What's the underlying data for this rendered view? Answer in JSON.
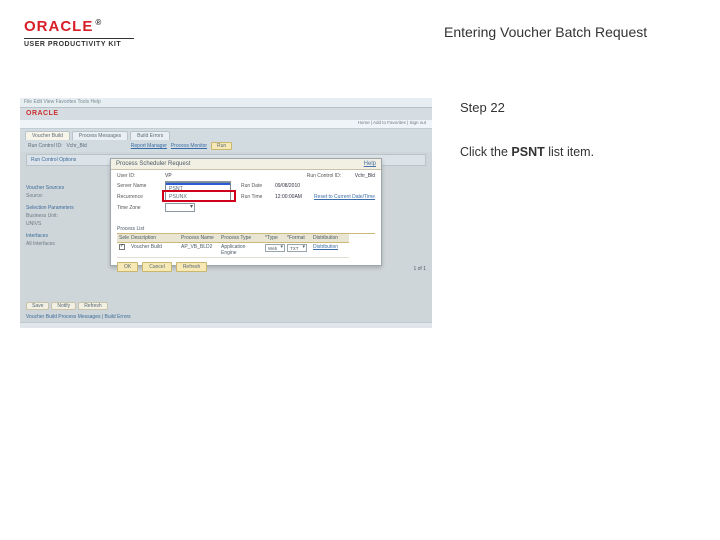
{
  "header": {
    "logo_main": "ORACLE",
    "logo_reg": "®",
    "logo_sub": "USER PRODUCTIVITY KIT",
    "doc_title": "Entering Voucher Batch Request"
  },
  "instruction": {
    "step_label": "Step 22",
    "action_pre": "Click the ",
    "action_bold": "PSNT",
    "action_post": " list item."
  },
  "shot": {
    "chrome_text": "File  Edit  View  Favorites  Tools  Help",
    "brand": "ORACLE",
    "subnav": "Home  |  Add to Favorites  |  Sign out",
    "tabs": [
      "Voucher Build",
      "Process Messages",
      "Build Errors"
    ],
    "row_labels": {
      "runcntl": "Run Control ID:",
      "runcntl_val": "Vchr_Bld",
      "report_mgr": "Report Manager",
      "proc_monitor": "Process Monitor",
      "run": "Run"
    },
    "group_header": "Run Control Options",
    "side": {
      "hdr1": "Voucher Sources",
      "v1": "Source:",
      "hdr2": "Selection Parameters",
      "v2": "Business Unit:",
      "v3": "UNIVS",
      "hdr3": "Interfaces",
      "v4": "All Interfaces"
    },
    "foot_tabs": [
      "Save",
      "Notify",
      "Refresh"
    ],
    "footline": "Voucher Build Process Messages | Build Errors",
    "nav_right": "1 of 1"
  },
  "modal": {
    "title": "Process Scheduler Request",
    "help": "Help",
    "user_lbl": "User ID:",
    "user_val": "VP",
    "runctl_lbl": "Run Control ID:",
    "runctl_val": "Vchr_Bld",
    "server_lbl": "Server Name",
    "server_sel": "",
    "rundate_lbl": "Run Date",
    "rundate_val": "09/08/2010",
    "recur_lbl": "Recurrence",
    "recur_sel": "",
    "runtime_lbl": "Run Time",
    "runtime_val": "12:00:00AM",
    "reset_link": "Reset to Current Date/Time",
    "tz_lbl": "Time Zone",
    "tz_sel": "",
    "list_header": "Process List",
    "th": [
      "Select",
      "Description",
      "Process Name",
      "Process Type",
      "*Type",
      "*Format",
      "Distribution"
    ],
    "row": {
      "desc": "Voucher Build",
      "pname": "AP_VB_BLD2",
      "ptype": "Application Engine",
      "type": "Web",
      "format": "TXT",
      "dist": "Distribution"
    },
    "btns": [
      "OK",
      "Cancel",
      "Refresh"
    ],
    "dropdown": {
      "opt_blank": " ",
      "opt_psnt": "PSNT",
      "opt_psunx": "PSUNX"
    }
  }
}
